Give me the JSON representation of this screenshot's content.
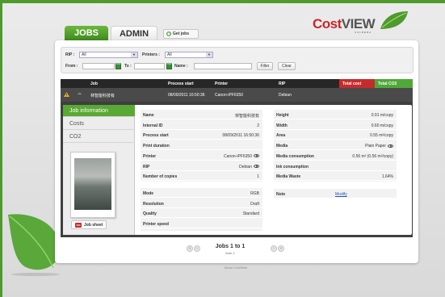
{
  "colors": {
    "brand_green": "#4f9a2c",
    "tab_active": "#59a934",
    "total_cost_header": "#c62b2b",
    "total_co2_header": "#4fa838",
    "logo_red": "#c8262c"
  },
  "logo": {
    "cost": "Cost",
    "view": "VIEW",
    "subtitle": "CALDERA"
  },
  "tabs": {
    "jobs": "JOBS",
    "admin": "ADMIN"
  },
  "toolbar": {
    "get_jobs": "Get jobs",
    "get_jobs_icon": "refresh-icon"
  },
  "filter": {
    "rip_label": "RIP :",
    "rip_value": "All",
    "printers_label": "Printers :",
    "printers_value": "All",
    "from_label": "From :",
    "to_label": "To :",
    "name_label": "Name :",
    "filter_button": "Filter",
    "clear_button": "Clear"
  },
  "grid": {
    "headers": {
      "job": "Job",
      "process_start": "Process start",
      "printer": "Printer",
      "rip": "RIP",
      "total_cost": "Total cost",
      "total_co2": "Total CO2"
    },
    "row": {
      "warning_icon": "warning-icon",
      "link_icon": "link-icon",
      "job": "林智能科技有",
      "process_start": "08/09/2011 16:50:36",
      "printer": "Canon-iPF6350",
      "rip": "Debian"
    }
  },
  "sidebar": {
    "items": [
      "Job information",
      "Costs",
      "CO2"
    ],
    "job_sheet": "Job sheet"
  },
  "info_left": [
    {
      "k": "Name",
      "v": "林智能科技有"
    },
    {
      "k": "Internal ID",
      "v": "2"
    },
    {
      "k": "Process start",
      "v": "08/09/2011 16:50:36"
    },
    {
      "k": "Print duration",
      "v": ""
    },
    {
      "k": "Printer",
      "v": "Canon-iPF6350"
    },
    {
      "k": "RIP",
      "v": "Debian"
    },
    {
      "k": "Number of copies",
      "v": "1"
    }
  ],
  "info_mode": [
    {
      "k": "Mode",
      "v": "RGB"
    },
    {
      "k": "Resolution",
      "v": "Draft"
    },
    {
      "k": "Quality",
      "v": "Standard"
    },
    {
      "k": "Printer speed",
      "v": ""
    }
  ],
  "info_right": [
    {
      "k": "Height",
      "v": "0.91 m/copy"
    },
    {
      "k": "Width",
      "v": "0.60 m/copy"
    },
    {
      "k": "Area",
      "v": "0.55 m²/copy"
    },
    {
      "k": "Media",
      "v": "Plain Paper"
    },
    {
      "k": "Media consumption",
      "v": "0.56 m² (0.56 m²/copy)"
    },
    {
      "k": "Ink consumption",
      "v": ""
    },
    {
      "k": "Media Waste",
      "v": "1.64%"
    }
  ],
  "note": {
    "k": "Note",
    "v": "Modify"
  },
  "pager": {
    "text": "Jobs 1 to 1",
    "from": "from 1",
    "first": "«",
    "prev": "‹",
    "next": "›",
    "last": "»"
  },
  "footer": {
    "about": "About CostView"
  }
}
